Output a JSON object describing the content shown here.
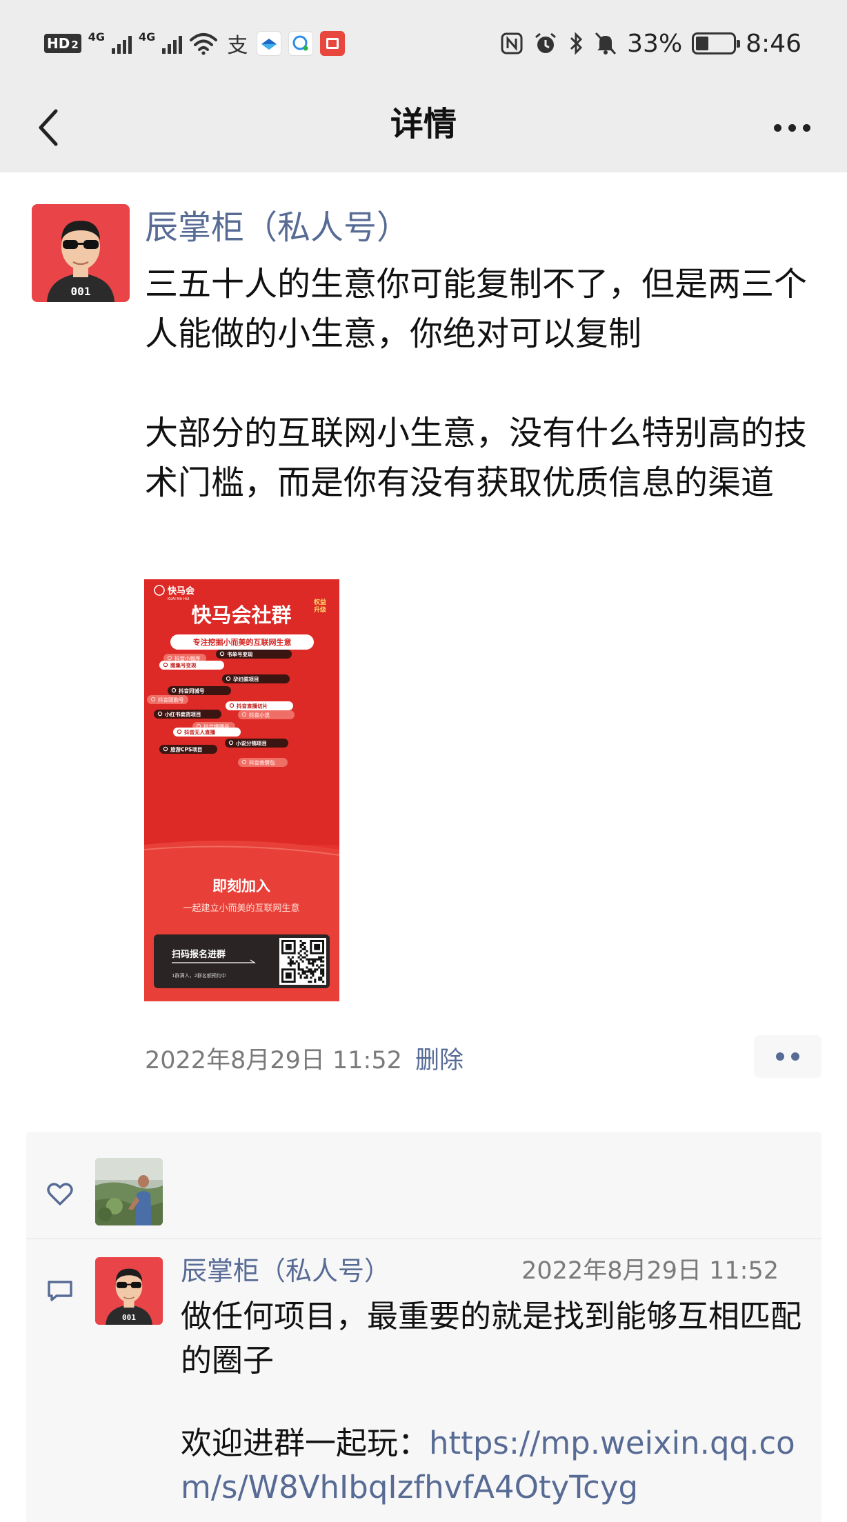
{
  "status_bar": {
    "hd_label": "HD",
    "sim_label": "2",
    "net1": "4G",
    "net2": "4G",
    "alipay_glyph": "支",
    "battery_percent": "33%",
    "time": "8:46",
    "icons": [
      "hd-icon",
      "signal-icon",
      "signal-icon",
      "wifi-icon",
      "alipay-icon",
      "app-icon",
      "chat-icon",
      "app-icon",
      "nfc-icon",
      "alarm-icon",
      "bluetooth-icon",
      "mute-icon",
      "battery-icon"
    ]
  },
  "nav": {
    "title": "详情"
  },
  "post": {
    "author": "辰掌柜（私人号）",
    "text": "三五十人的生意你可能复制不了，但是两三个人能做的小生意，你绝对可以复制\n\n大部分的互联网小生意，没有什么特别高的技术门槛，而是你有没有获取优质信息的渠道",
    "time": "2022年8月29日 11:52",
    "delete_label": "删除",
    "poster": {
      "brand": "快马会",
      "brand_sub": "KUAI MA HUI",
      "corner_badge": "权益\n升级",
      "title": "快马会社群",
      "subtitle": "专注挖掘小而美的互联网生意",
      "tags": [
        "抖音小程序",
        "图集号变现",
        "书单号变现",
        "孕妇装项目",
        "抖音同城号",
        "抖音团购号",
        "抖音直播切片",
        "抖音小说",
        "小红书卖货项目",
        "抖音播播号",
        "抖音无人直播",
        "小说分销项目",
        "旅游CPS项目",
        "抖音表情包"
      ],
      "cta_title": "即刻加入",
      "cta_sub": "一起建立小而美的互联网生意",
      "scan_label": "扫码报名进群",
      "scan_note": "1群满人，2群名额预约中"
    }
  },
  "likes": {
    "count": 1
  },
  "comment": {
    "author": "辰掌柜（私人号）",
    "time": "2022年8月29日 11:52",
    "text": "做任何项目，最重要的就是找到能够互相匹配的圈子",
    "invite_prefix": "欢迎进群一起玩：",
    "link": "https://mp.weixin.qq.com/s/W8VhIbqIzfhvfA4OtyTcyg"
  },
  "colors": {
    "link_blue": "#576b95",
    "nav_bg": "#ededed",
    "panel_bg": "#f7f7f7",
    "poster_red": "#e5322d"
  }
}
